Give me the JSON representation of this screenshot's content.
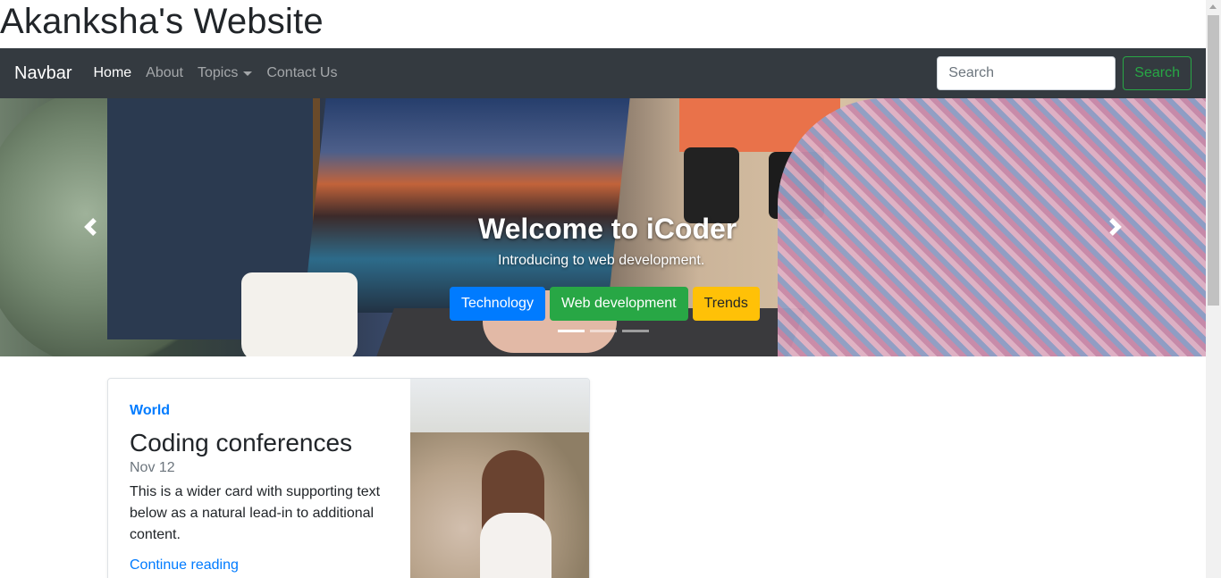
{
  "site": {
    "title": "Akanksha's Website"
  },
  "navbar": {
    "brand": "Navbar",
    "links": [
      {
        "label": "Home",
        "active": true
      },
      {
        "label": "About",
        "active": false
      },
      {
        "label": "Topics",
        "active": false,
        "dropdown": true
      },
      {
        "label": "Contact Us",
        "active": false
      }
    ],
    "search": {
      "placeholder": "Search",
      "value": "",
      "button_label": "Search"
    }
  },
  "carousel": {
    "title": "Welcome to iCoder",
    "subtitle": "Introducing to web development.",
    "buttons": [
      {
        "label": "Technology",
        "color": "#007bff"
      },
      {
        "label": "Web development",
        "color": "#28a745"
      },
      {
        "label": "Trends",
        "color": "#ffc107"
      }
    ],
    "indicator_count": 3,
    "active_indicator": 0,
    "prev_icon": "chevron-left-icon",
    "next_icon": "chevron-right-icon"
  },
  "card": {
    "category": "World",
    "title": "Coding conferences",
    "date": "Nov 12",
    "text": "This is a wider card with supporting text below as a natural lead-in to additional content.",
    "link_label": "Continue reading"
  },
  "colors": {
    "navbar_bg": "#343a40",
    "primary": "#007bff",
    "success": "#28a745",
    "warning": "#ffc107"
  }
}
